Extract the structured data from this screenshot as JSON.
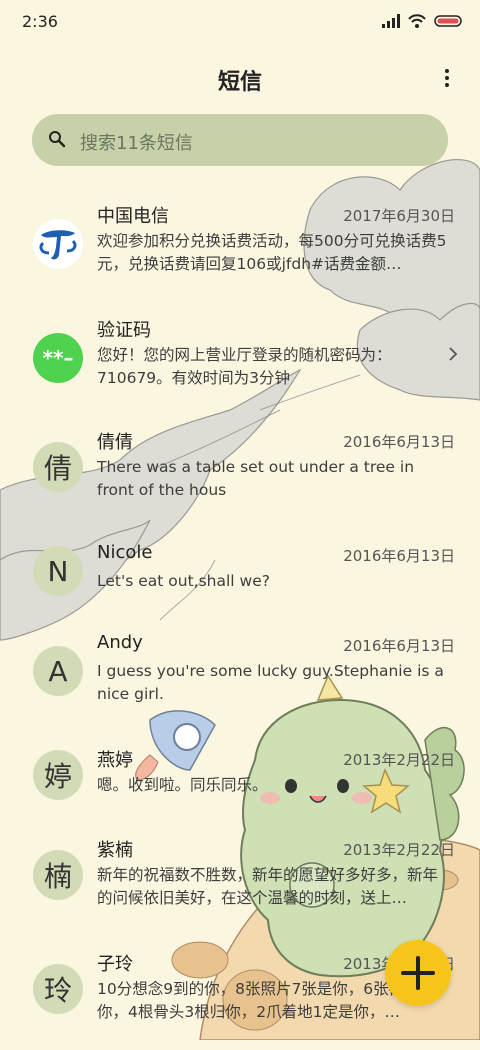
{
  "status": {
    "time": "2:36"
  },
  "header": {
    "title": "短信"
  },
  "search": {
    "placeholder": "搜索11条短信"
  },
  "conversations": [
    {
      "name": "中国电信",
      "date": "2017年6月30日",
      "preview": "欢迎参加积分兑换话费活动，每500分可兑换话费5元，兑换话费请回复106或jfdh#话费金额…",
      "avatar": "telecom-logo"
    },
    {
      "name": "验证码",
      "date": "",
      "preview": "您好！您的网上营业厅登录的随机密码为：710679。有效时间为3分钟",
      "avatar_text": "**–"
    },
    {
      "name": "倩倩",
      "date": "2016年6月13日",
      "preview": "There was a table set out under a tree in front of the hous",
      "avatar_text": "倩"
    },
    {
      "name": "Nicole",
      "date": "2016年6月13日",
      "preview": "Let's eat out,shall we?",
      "avatar_text": "N"
    },
    {
      "name": "Andy",
      "date": "2016年6月13日",
      "preview": "I guess you're some lucky guy.Stephanie is a nice girl.",
      "avatar_text": "A"
    },
    {
      "name": "燕婷",
      "date": "2013年2月22日",
      "preview": "嗯。收到啦。同乐同乐。",
      "avatar_text": "婷"
    },
    {
      "name": "紫楠",
      "date": "2013年2月22日",
      "preview": "新年的祝福数不胜数，新年的愿望好多好多，新年的问候依旧美好，在这个温馨的时刻，送上…",
      "avatar_text": "楠"
    },
    {
      "name": "子玲",
      "date": "2013年2月22日",
      "preview": "10分想念9到的你，8张照片7张是你，6张都只像你，4根骨头3根归你，2爪着地1定是你，…",
      "avatar_text": "玲"
    }
  ],
  "colors": {
    "background": "#fbf6e0",
    "search_bg": "#c6d1a9",
    "avatar_bg": "#d2dbb6",
    "verify_avatar": "#4fd24f",
    "fab": "#f6c41a",
    "telecom_blue": "#1d5fb0"
  }
}
